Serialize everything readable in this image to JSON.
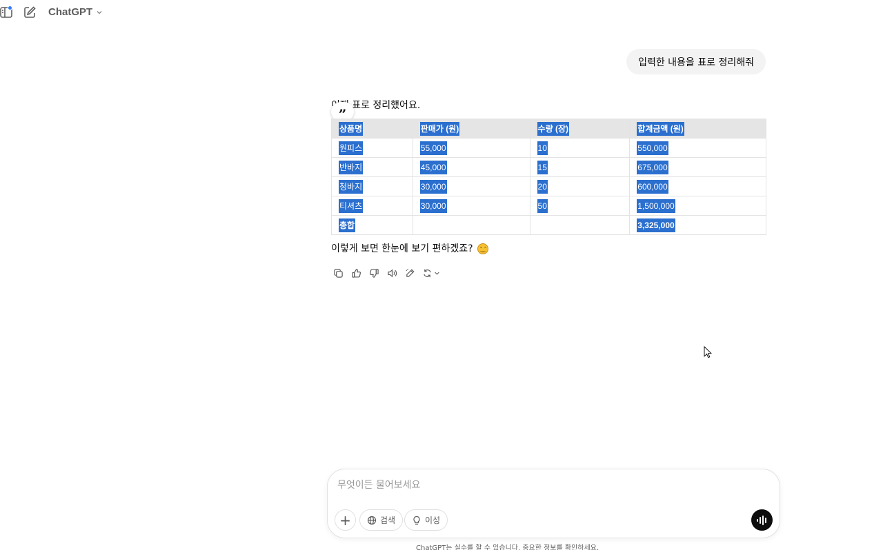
{
  "header": {
    "model_name": "ChatGPT",
    "icons": [
      "sidebar-icon",
      "new-chat-icon",
      "chevron-down-icon"
    ]
  },
  "conversation": {
    "user_message": "입력한 내용을 표로 정리해줘",
    "assistant": {
      "intro": "이제 표로 정리했어요.",
      "quote_glyph": "”",
      "table": {
        "headers": [
          "상품명",
          "판매가 (원)",
          "수량 (장)",
          "합계금액 (원)"
        ],
        "rows": [
          [
            "원피스",
            "55,000",
            "10",
            "550,000"
          ],
          [
            "반바지",
            "45,000",
            "15",
            "675,000"
          ],
          [
            "청바지",
            "30,000",
            "20",
            "600,000"
          ],
          [
            "티셔츠",
            "30,000",
            "50",
            "1,500,000"
          ]
        ],
        "total": [
          "총합",
          "",
          "",
          "3,325,000"
        ]
      },
      "outro": "이렇게 보면 한눈에 보기 편하겠죠?",
      "action_icons": [
        "copy-icon",
        "thumbs-up-icon",
        "thumbs-down-icon",
        "speaker-icon",
        "edit-icon",
        "regenerate-icon"
      ]
    }
  },
  "composer": {
    "placeholder": "무엇이든 물어보세요",
    "add_label": "+",
    "search_label": "검색",
    "reason_label": "이성",
    "disclaimer": "ChatGPT는 실수를 할 수 있습니다. 중요한 정보를 확인하세요."
  },
  "colors": {
    "selection": "#2b6fcf",
    "notification_dot": "#2f7cf6",
    "bubble_bg": "#f3f3f3"
  }
}
